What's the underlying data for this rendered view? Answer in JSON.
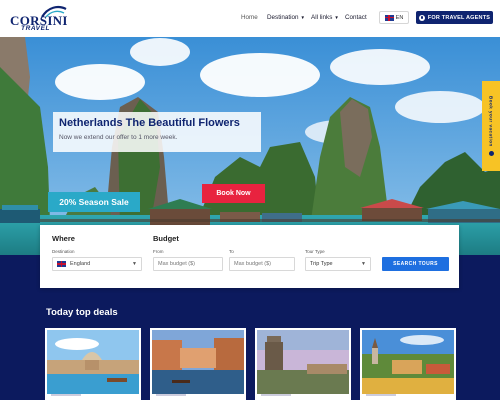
{
  "header": {
    "logo_text": "CORSINI",
    "logo_sub": "TRAVEL",
    "nav": {
      "home": "Home",
      "destination": "Destination",
      "all_links": "All links",
      "contact": "Contact"
    },
    "language": "EN",
    "agents_button": "FOR TRAVEL AGENTS"
  },
  "hero": {
    "title": "Netherlands The Beautiful Flowers",
    "subtitle": "Now we extend our offer to 1 more week.",
    "sale_badge": "20% Season Sale",
    "cta": "Book Now",
    "side_tab": "Book your vacation"
  },
  "search": {
    "where_heading": "Where",
    "budget_heading": "Budget",
    "destination_label": "Destination",
    "destination_value": "England",
    "from_label": "From",
    "from_placeholder": "Max budget ($)",
    "to_label": "To",
    "to_placeholder": "Max budget ($)",
    "tour_type_label": "Tour Type",
    "tour_type_value": "Trip Type",
    "button": "SEARCH TOURS"
  },
  "deals": {
    "title": "Today top deals"
  },
  "colors": {
    "brand_navy": "#0f2470",
    "page_bg": "#0c1a5e",
    "accent_red": "#e8233f",
    "accent_teal": "#2aa9c8",
    "accent_yellow": "#f7c325",
    "search_blue": "#1e6fe0"
  }
}
